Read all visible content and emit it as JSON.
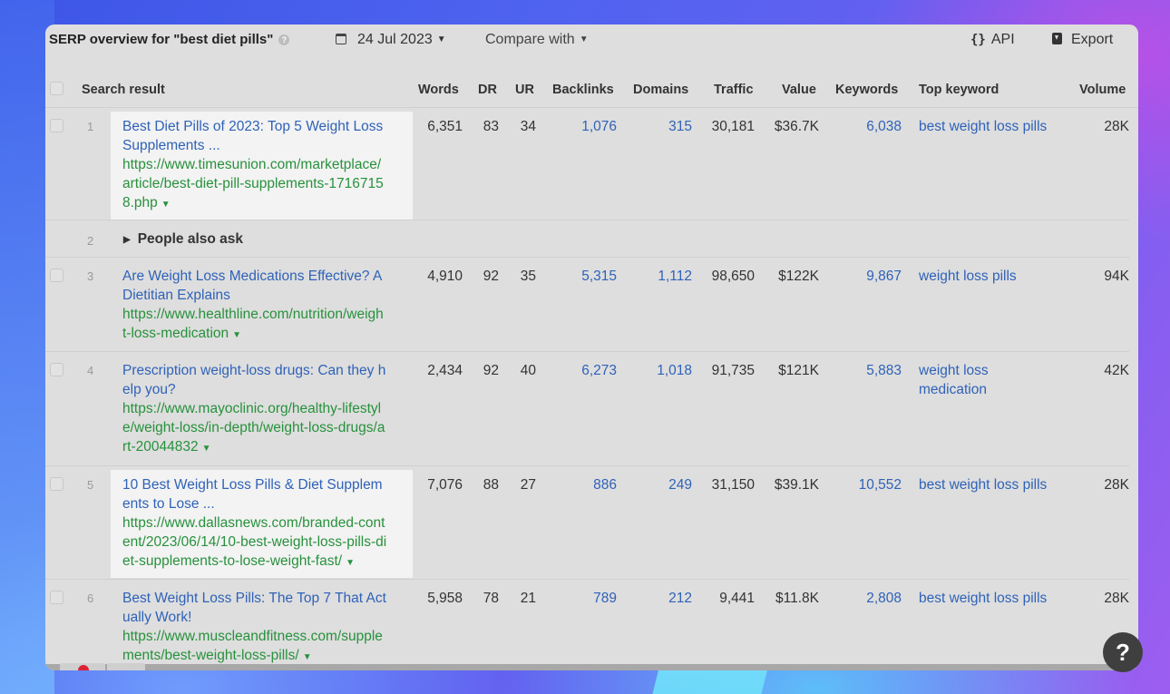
{
  "toolbar": {
    "title": "SERP overview for \"best diet pills\"",
    "date": "24 Jul 2023",
    "compare": "Compare with",
    "api": "API",
    "export": "Export"
  },
  "columns": {
    "search_result": "Search result",
    "words": "Words",
    "dr": "DR",
    "ur": "UR",
    "backlinks": "Backlinks",
    "domains": "Domains",
    "traffic": "Traffic",
    "value": "Value",
    "keywords": "Keywords",
    "top_keyword": "Top keyword",
    "volume": "Volume"
  },
  "rows": [
    {
      "pos": "1",
      "title_lines": [
        "Best Diet Pills of 2023: Top 5 Weight Loss",
        "Supplements ..."
      ],
      "url_lines": [
        "https://www.timesunion.com/marketplace/",
        "article/best-diet-pill-supplements-1716715",
        "8.php"
      ],
      "words": "6,351",
      "dr": "83",
      "ur": "34",
      "backlinks": "1,076",
      "domains": "315",
      "traffic": "30,181",
      "value": "$36.7K",
      "keywords": "6,038",
      "top_keyword_lines": [
        "best weight loss pills"
      ],
      "volume": "28K"
    },
    {
      "pos": "2",
      "paa": "People also ask"
    },
    {
      "pos": "3",
      "title_lines": [
        "Are Weight Loss Medications Effective? A",
        "Dietitian Explains"
      ],
      "url_lines": [
        "https://www.healthline.com/nutrition/weigh",
        "t-loss-medication"
      ],
      "words": "4,910",
      "dr": "92",
      "ur": "35",
      "backlinks": "5,315",
      "domains": "1,112",
      "traffic": "98,650",
      "value": "$122K",
      "keywords": "9,867",
      "top_keyword_lines": [
        "weight loss pills"
      ],
      "volume": "94K"
    },
    {
      "pos": "4",
      "title_lines": [
        "Prescription weight-loss drugs: Can they h",
        "elp you?"
      ],
      "url_lines": [
        "https://www.mayoclinic.org/healthy-lifestyl",
        "e/weight-loss/in-depth/weight-loss-drugs/a",
        "rt-20044832"
      ],
      "words": "2,434",
      "dr": "92",
      "ur": "40",
      "backlinks": "6,273",
      "domains": "1,018",
      "traffic": "91,735",
      "value": "$121K",
      "keywords": "5,883",
      "top_keyword_lines": [
        "weight loss",
        "medication"
      ],
      "volume": "42K"
    },
    {
      "pos": "5",
      "title_lines": [
        "10 Best Weight Loss Pills & Diet Supplem",
        "ents to Lose ..."
      ],
      "url_lines": [
        "https://www.dallasnews.com/branded-cont",
        "ent/2023/06/14/10-best-weight-loss-pills-di",
        "et-supplements-to-lose-weight-fast/"
      ],
      "words": "7,076",
      "dr": "88",
      "ur": "27",
      "backlinks": "886",
      "domains": "249",
      "traffic": "31,150",
      "value": "$39.1K",
      "keywords": "10,552",
      "top_keyword_lines": [
        "best weight loss pills"
      ],
      "volume": "28K"
    },
    {
      "pos": "6",
      "title_lines": [
        "Best Weight Loss Pills: The Top 7 That Act",
        "ually Work!"
      ],
      "url_lines": [
        "https://www.muscleandfitness.com/supple",
        "ments/best-weight-loss-pills/"
      ],
      "words": "5,958",
      "dr": "78",
      "ur": "21",
      "backlinks": "789",
      "domains": "212",
      "traffic": "9,441",
      "value": "$11.8K",
      "keywords": "2,808",
      "top_keyword_lines": [
        "best weight loss pills"
      ],
      "volume": "28K"
    }
  ],
  "help": "?"
}
